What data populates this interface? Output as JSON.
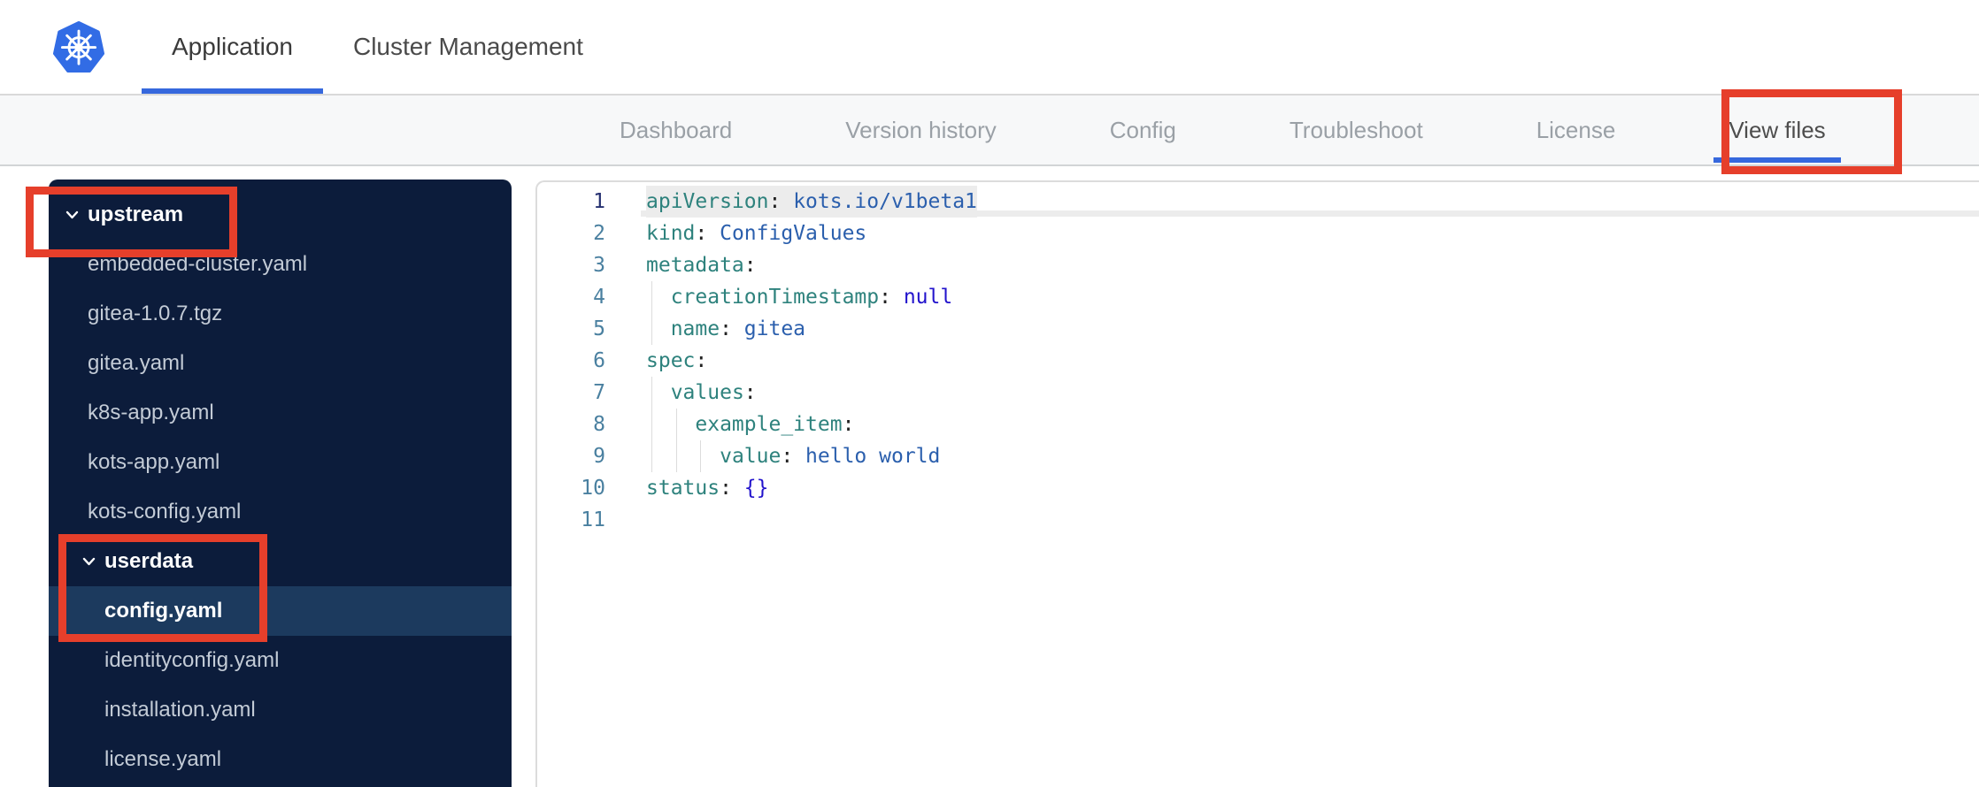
{
  "header": {
    "tabs": [
      {
        "label": "Application",
        "active": true
      },
      {
        "label": "Cluster Management",
        "active": false
      }
    ]
  },
  "subnav": {
    "tabs": [
      {
        "label": "Dashboard",
        "active": false
      },
      {
        "label": "Version history",
        "active": false
      },
      {
        "label": "Config",
        "active": false
      },
      {
        "label": "Troubleshoot",
        "active": false
      },
      {
        "label": "License",
        "active": false
      },
      {
        "label": "View files",
        "active": true
      }
    ]
  },
  "file_tree": {
    "items": [
      {
        "type": "folder",
        "label": "upstream",
        "level": 0,
        "expanded": true
      },
      {
        "type": "file",
        "label": "embedded-cluster.yaml",
        "level": 1
      },
      {
        "type": "file",
        "label": "gitea-1.0.7.tgz",
        "level": 1
      },
      {
        "type": "file",
        "label": "gitea.yaml",
        "level": 1
      },
      {
        "type": "file",
        "label": "k8s-app.yaml",
        "level": 1
      },
      {
        "type": "file",
        "label": "kots-app.yaml",
        "level": 1
      },
      {
        "type": "file",
        "label": "kots-config.yaml",
        "level": 1
      },
      {
        "type": "folder",
        "label": "userdata",
        "level": 1,
        "expanded": true
      },
      {
        "type": "file",
        "label": "config.yaml",
        "level": 2,
        "selected": true
      },
      {
        "type": "file",
        "label": "identityconfig.yaml",
        "level": 2
      },
      {
        "type": "file",
        "label": "installation.yaml",
        "level": 2
      },
      {
        "type": "file",
        "label": "license.yaml",
        "level": 2
      }
    ]
  },
  "editor": {
    "lines": [
      {
        "n": "1",
        "sel": true,
        "guides": 0,
        "segs": [
          [
            "k",
            "apiVersion"
          ],
          [
            "p",
            ": "
          ],
          [
            "v",
            "kots.io/v1beta1"
          ]
        ]
      },
      {
        "n": "2",
        "guides": 0,
        "segs": [
          [
            "k",
            "kind"
          ],
          [
            "p",
            ": "
          ],
          [
            "v",
            "ConfigValues"
          ]
        ]
      },
      {
        "n": "3",
        "guides": 0,
        "segs": [
          [
            "k",
            "metadata"
          ],
          [
            "p",
            ":"
          ]
        ]
      },
      {
        "n": "4",
        "guides": 1,
        "segs": [
          [
            "p",
            "  "
          ],
          [
            "k",
            "creationTimestamp"
          ],
          [
            "p",
            ": "
          ],
          [
            "a",
            "null"
          ]
        ]
      },
      {
        "n": "5",
        "guides": 1,
        "segs": [
          [
            "p",
            "  "
          ],
          [
            "k",
            "name"
          ],
          [
            "p",
            ": "
          ],
          [
            "v",
            "gitea"
          ]
        ]
      },
      {
        "n": "6",
        "guides": 0,
        "segs": [
          [
            "k",
            "spec"
          ],
          [
            "p",
            ":"
          ]
        ]
      },
      {
        "n": "7",
        "guides": 1,
        "segs": [
          [
            "p",
            "  "
          ],
          [
            "k",
            "values"
          ],
          [
            "p",
            ":"
          ]
        ]
      },
      {
        "n": "8",
        "guides": 2,
        "segs": [
          [
            "p",
            "    "
          ],
          [
            "k",
            "example_item"
          ],
          [
            "p",
            ":"
          ]
        ]
      },
      {
        "n": "9",
        "guides": 3,
        "segs": [
          [
            "p",
            "      "
          ],
          [
            "k",
            "value"
          ],
          [
            "p",
            ": "
          ],
          [
            "v",
            "hello world"
          ]
        ]
      },
      {
        "n": "10",
        "guides": 0,
        "segs": [
          [
            "k",
            "status"
          ],
          [
            "p",
            ": "
          ],
          [
            "a",
            "{}"
          ]
        ]
      },
      {
        "n": "11",
        "guides": 0,
        "segs": []
      }
    ]
  },
  "annotations": {
    "color": "#e63f2b",
    "boxes": [
      "view-files-tab",
      "upstream-folder",
      "userdata-config-files"
    ]
  },
  "colors": {
    "accent_blue": "#3668dd",
    "logo_blue": "#326ce5",
    "sidebar_bg": "#0c1c3b",
    "sidebar_selected": "#1c3a5e",
    "yaml_key": "#2e827d",
    "yaml_value": "#2b5fad",
    "yaml_atom": "#2213cc"
  }
}
